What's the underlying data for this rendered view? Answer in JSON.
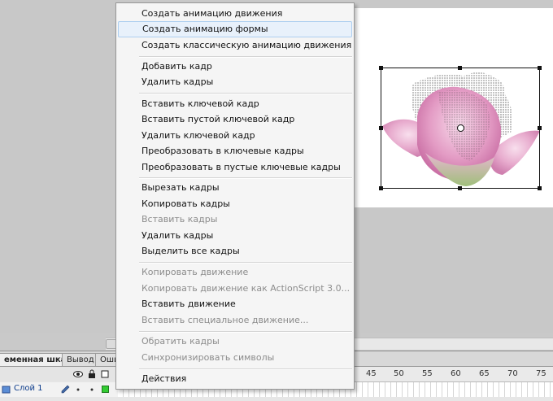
{
  "menu": {
    "items": [
      {
        "label": "Создать анимацию движения",
        "enabled": true
      },
      {
        "label": "Создать анимацию формы",
        "enabled": true,
        "highlighted": true
      },
      {
        "label": "Создать классическую анимацию движения",
        "enabled": true
      },
      {
        "label": "Добавить кадр",
        "enabled": true
      },
      {
        "label": "Удалить кадры",
        "enabled": true
      },
      {
        "label": "Вставить ключевой кадр",
        "enabled": true
      },
      {
        "label": "Вставить пустой ключевой кадр",
        "enabled": true
      },
      {
        "label": "Удалить ключевой кадр",
        "enabled": true
      },
      {
        "label": "Преобразовать в ключевые кадры",
        "enabled": true
      },
      {
        "label": "Преобразовать в пустые ключевые кадры",
        "enabled": true
      },
      {
        "label": "Вырезать кадры",
        "enabled": true
      },
      {
        "label": "Копировать кадры",
        "enabled": true
      },
      {
        "label": "Вставить кадры",
        "enabled": false
      },
      {
        "label": "Удалить кадры",
        "enabled": true
      },
      {
        "label": "Выделить все кадры",
        "enabled": true
      },
      {
        "label": "Копировать движение",
        "enabled": false
      },
      {
        "label": "Копировать движение как ActionScript 3.0...",
        "enabled": false
      },
      {
        "label": "Вставить движение",
        "enabled": true
      },
      {
        "label": "Вставить специальное движение...",
        "enabled": false
      },
      {
        "label": "Обратить кадры",
        "enabled": false
      },
      {
        "label": "Синхронизировать символы",
        "enabled": false
      },
      {
        "label": "Действия",
        "enabled": true
      }
    ]
  },
  "timeline": {
    "tabs": [
      "еменная шкала",
      "Вывод",
      "Оши"
    ],
    "layer_name": "Слой 1",
    "ruler_labels": [
      "45",
      "50",
      "55",
      "60",
      "65",
      "70",
      "75"
    ],
    "layer_color": "#33cc33"
  },
  "colors": {
    "highlight_bg": "#e8f1fb",
    "disabled_text": "#8c8c8c"
  }
}
